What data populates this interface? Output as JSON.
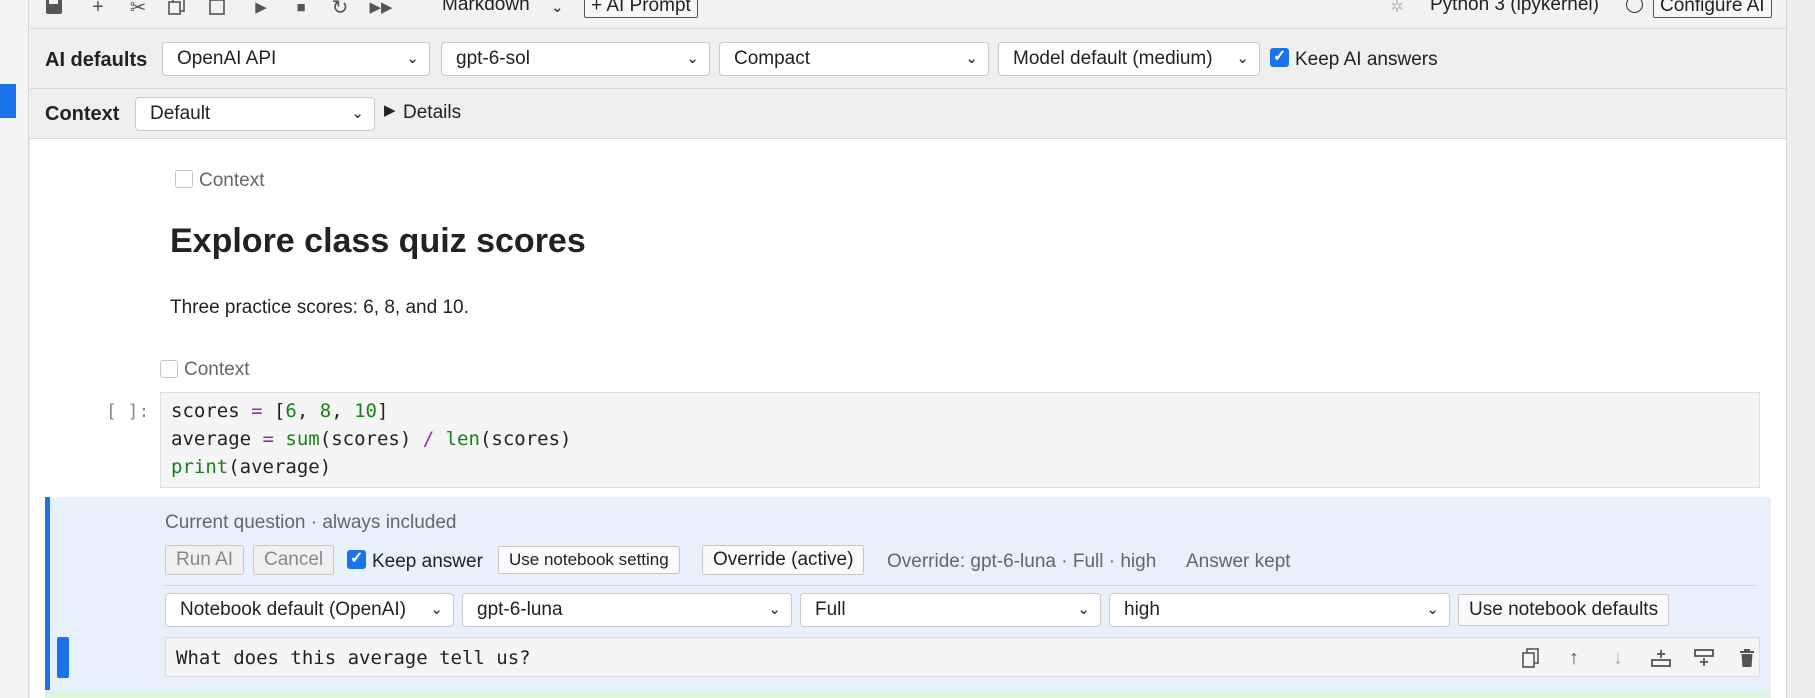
{
  "toolbar": {
    "cell_type": "Markdown",
    "ai_prompt_button": "+ AI Prompt",
    "kernel_name": "Python 3 (ipykernel)",
    "configure_ai_button": "Configure AI"
  },
  "ai_defaults": {
    "label": "AI defaults",
    "provider": "OpenAI API",
    "model": "gpt-6-sol",
    "context_mode": "Compact",
    "reasoning": "Model default (medium)",
    "keep_answers_checked": true,
    "keep_answers_label": "Keep AI answers"
  },
  "context_bar": {
    "label": "Context",
    "selected": "Default",
    "details_label": "Details"
  },
  "markdown_cell": {
    "context_label": "Context",
    "context_checked": false,
    "title": "Explore class quiz scores",
    "body": "Three practice scores: 6, 8, and 10."
  },
  "code_cell": {
    "context_label": "Context",
    "context_checked": false,
    "prompt": "[ ]:"
  },
  "ai_cell": {
    "header": "Current question · always included",
    "run_button": "Run AI",
    "cancel_button": "Cancel",
    "keep_answer_checked": true,
    "keep_answer_label": "Keep answer",
    "use_notebook_setting_button": "Use notebook setting",
    "override_button": "Override (active)",
    "override_summary": "Override: gpt-6-luna · Full · high",
    "answer_status": "Answer kept",
    "provider": "Notebook default (OpenAI)",
    "model": "gpt-6-luna",
    "context_mode": "Full",
    "reasoning": "high",
    "use_defaults_button": "Use notebook defaults",
    "question": "What does this average tell us?"
  },
  "colors": {
    "accent": "#1a73e8",
    "ai_cell_bg": "#e8f0fb"
  }
}
